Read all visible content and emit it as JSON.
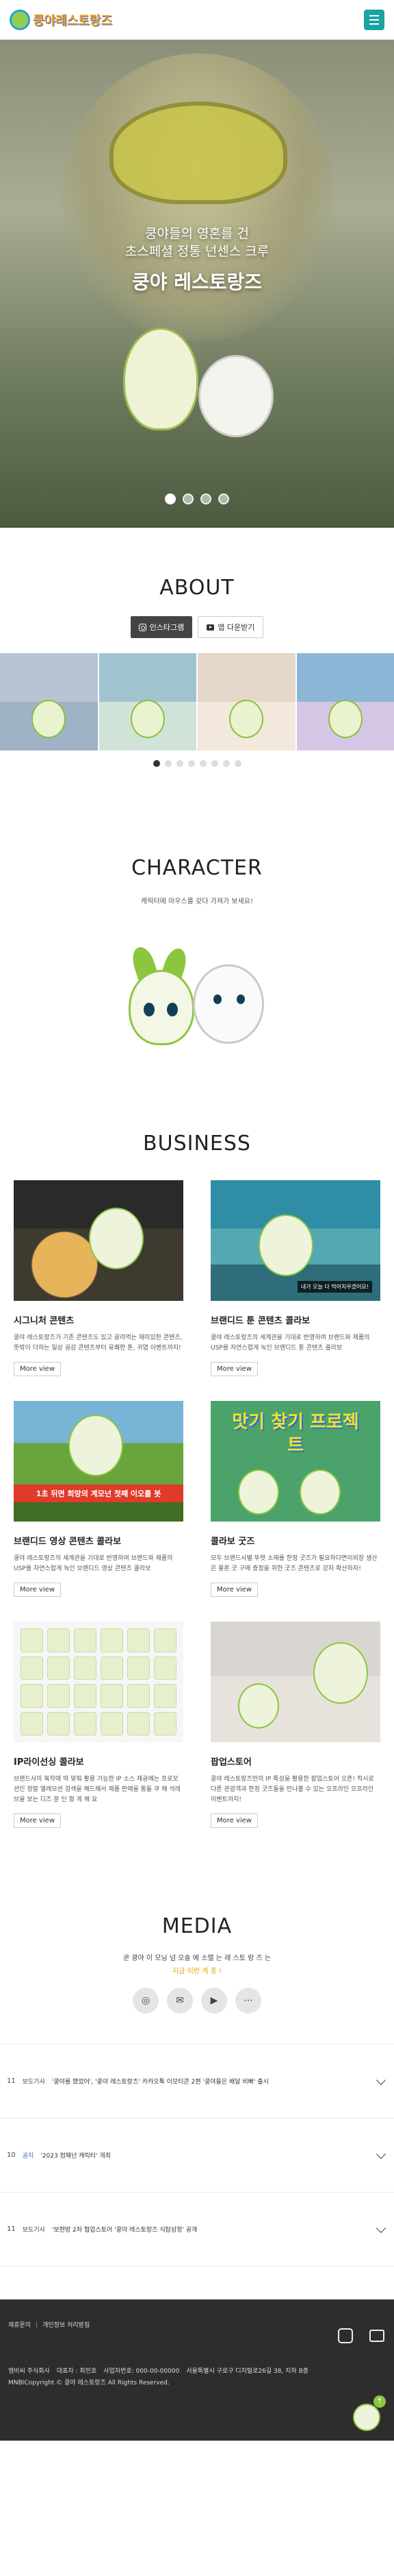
{
  "header": {
    "logo_text": "쿵야레스토랑즈",
    "menu_label": ""
  },
  "hero": {
    "line1": "쿵야들의 영혼를 건",
    "line2": "초스페셜 정통 넌센스 크루",
    "title": "쿵야 레스토랑즈",
    "slides_total": 4,
    "slide_active": 1
  },
  "about": {
    "title": "ABOUT",
    "instagram_label": "인스타그램",
    "youtube_label": "앱 다운받기",
    "frames": [
      {
        "caption": ""
      },
      {
        "caption": ""
      },
      {
        "caption": ""
      },
      {
        "caption": ""
      }
    ],
    "dots_total": 8,
    "dot_active": 1
  },
  "character": {
    "title": "CHARACTER",
    "subtitle": "캐릭터에 마우스를 갖다 가져가 보세요!"
  },
  "business": {
    "title": "BUSINESS",
    "more_label": "More view",
    "items": [
      {
        "title": "시그니처 콘텐츠",
        "desc": "쿵야 레스토랑즈가 기존 콘텐츠도 있고 골라먹는 재미있한 콘텐츠, 뜻밖이 더하는 일상 공감 콘텐츠부터 유쾌한 톤, 귀엽 이벤트까지!"
      },
      {
        "title": "브랜디드 툰 콘텐츠 콜라보",
        "desc": "쿵야 레스토랑즈의 세계관을 기대로 반영하여 브랜드와 제품의 USP를 자연스럽게 녹인 브랜디드 툰 콘텐츠 콜라보",
        "caption": "내가 오늘 다 먹어치우겠어요!"
      },
      {
        "title": "브랜디드 영상 콘텐츠 콜라보",
        "desc": "쿵야 레스토랑즈의 세계관을 기대로 반영하여 브랜드와 제품의 USP를 자연스럽게 녹인 브랜디드 영상 콘텐츠 콜라보",
        "banner": "1초 뒤면 희망의 계모넌 첫째 이오를 봇"
      },
      {
        "title": "콜라보 굿즈",
        "desc": "모두 브랜드사별 뚜렷 소재를 한정 굿즈가 필요하다면이외장 생산은 물론 굿 구매 증정을 위한 굿즈 콘텐츠로 강자 확산하자!",
        "banner": "맛기 찾기 프로젝트"
      },
      {
        "title": "IP라이선싱 콜라보",
        "desc": "브랜드사의 복작에 딱 맞춰 활용 가능한 IP 소스 제공에는 프로모션인 정말 열레모션 검색을 해드해서 제품 판매을 통들 쿠 해 석레 브을 보는 디즈 분 인 형 게 해 요"
      },
      {
        "title": "팝업스토어",
        "desc": "쿵야 레스토랑즈만의 IP 특성을 활용한 팝업스토어 오픈! 적시로 다른 관광객과 한정 굿즈들을 만나볼 수 있는 오프라인 오프라인 이벤트까지!"
      }
    ]
  },
  "media": {
    "title": "MEDIA",
    "sub1": "쿤 쿵야 이 모닝 넘 오솔 에 소렐 는 레 스토 랑 즈 는",
    "sub2": "지금 이런 게 중 !",
    "social": [
      "instagram-icon",
      "mail-icon",
      "youtube-icon",
      "share-icon"
    ],
    "news": [
      {
        "num": "11",
        "cat": "보도기사",
        "cat_color": "#444444",
        "title": "'쿵야를 했었어', '쿵야 레스토랑즈' 카카오톡 이모티콘 2편 '쿵야들은 배달 비빠' 출시"
      },
      {
        "num": "10",
        "cat": "공지",
        "cat_color": "#3563d8",
        "title": "'2023 컴패넌 캐릭터' 개최"
      },
      {
        "num": "11",
        "cat": "보도기사",
        "cat_color": "#444444",
        "title": "'보현방 2차 협업스토어 '쿵야 레스토랑즈 식탐삼정' 공개"
      }
    ]
  },
  "footer": {
    "links": [
      "제휴문의",
      "개인정보 처리방침"
    ],
    "info": [
      "엠비씨 주식회사",
      "대표자 : 최민호",
      "사업자번호: 000-00-00000",
      "서울특별시 구로구 디지털로26길 38, 지하 B층"
    ],
    "copyright": "MNBICopyright © 쿵야 레스토랑즈 All Rights Reserved."
  }
}
